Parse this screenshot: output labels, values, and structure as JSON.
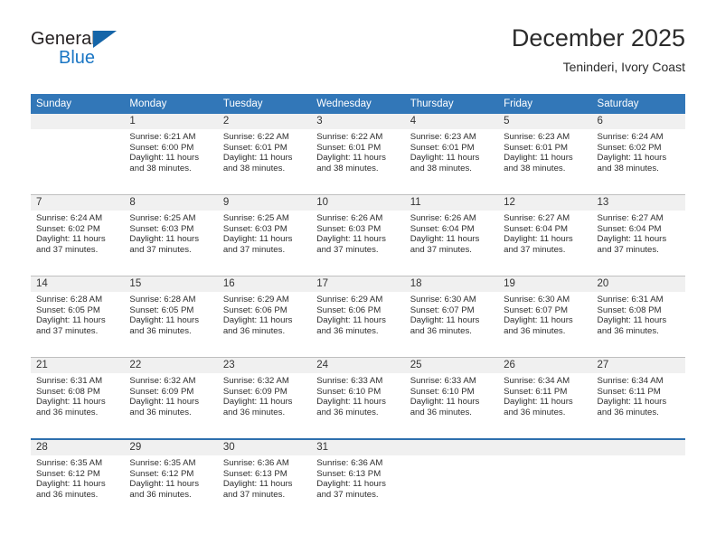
{
  "brand": {
    "line1": "General",
    "line2": "Blue",
    "logo_icon": "triangle-logo-icon",
    "accent": "#1a76c4",
    "triangle_color": "#1565a8"
  },
  "header": {
    "title": "December 2025",
    "subtitle": "Teninderi, Ivory Coast"
  },
  "theme": {
    "header_row_bg": "#3277b8",
    "daynum_bg": "#f0f0f0",
    "grid_line": "#bfbfbf",
    "blue_rule": "#2e6fad",
    "text": "#2e2e2e"
  },
  "calendar": {
    "weekday_headers": [
      "Sunday",
      "Monday",
      "Tuesday",
      "Wednesday",
      "Thursday",
      "Friday",
      "Saturday"
    ],
    "labels": {
      "sunrise_prefix": "Sunrise:",
      "sunset_prefix": "Sunset:",
      "daylight_prefix": "Daylight:"
    },
    "weeks": [
      [
        {
          "day": "",
          "empty": true
        },
        {
          "day": "1",
          "sunrise": "Sunrise: 6:21 AM",
          "sunset": "Sunset: 6:00 PM",
          "daylight_l1": "Daylight: 11 hours",
          "daylight_l2": "and 38 minutes."
        },
        {
          "day": "2",
          "sunrise": "Sunrise: 6:22 AM",
          "sunset": "Sunset: 6:01 PM",
          "daylight_l1": "Daylight: 11 hours",
          "daylight_l2": "and 38 minutes."
        },
        {
          "day": "3",
          "sunrise": "Sunrise: 6:22 AM",
          "sunset": "Sunset: 6:01 PM",
          "daylight_l1": "Daylight: 11 hours",
          "daylight_l2": "and 38 minutes."
        },
        {
          "day": "4",
          "sunrise": "Sunrise: 6:23 AM",
          "sunset": "Sunset: 6:01 PM",
          "daylight_l1": "Daylight: 11 hours",
          "daylight_l2": "and 38 minutes."
        },
        {
          "day": "5",
          "sunrise": "Sunrise: 6:23 AM",
          "sunset": "Sunset: 6:01 PM",
          "daylight_l1": "Daylight: 11 hours",
          "daylight_l2": "and 38 minutes."
        },
        {
          "day": "6",
          "sunrise": "Sunrise: 6:24 AM",
          "sunset": "Sunset: 6:02 PM",
          "daylight_l1": "Daylight: 11 hours",
          "daylight_l2": "and 38 minutes."
        }
      ],
      [
        {
          "day": "7",
          "sunrise": "Sunrise: 6:24 AM",
          "sunset": "Sunset: 6:02 PM",
          "daylight_l1": "Daylight: 11 hours",
          "daylight_l2": "and 37 minutes."
        },
        {
          "day": "8",
          "sunrise": "Sunrise: 6:25 AM",
          "sunset": "Sunset: 6:03 PM",
          "daylight_l1": "Daylight: 11 hours",
          "daylight_l2": "and 37 minutes."
        },
        {
          "day": "9",
          "sunrise": "Sunrise: 6:25 AM",
          "sunset": "Sunset: 6:03 PM",
          "daylight_l1": "Daylight: 11 hours",
          "daylight_l2": "and 37 minutes."
        },
        {
          "day": "10",
          "sunrise": "Sunrise: 6:26 AM",
          "sunset": "Sunset: 6:03 PM",
          "daylight_l1": "Daylight: 11 hours",
          "daylight_l2": "and 37 minutes."
        },
        {
          "day": "11",
          "sunrise": "Sunrise: 6:26 AM",
          "sunset": "Sunset: 6:04 PM",
          "daylight_l1": "Daylight: 11 hours",
          "daylight_l2": "and 37 minutes."
        },
        {
          "day": "12",
          "sunrise": "Sunrise: 6:27 AM",
          "sunset": "Sunset: 6:04 PM",
          "daylight_l1": "Daylight: 11 hours",
          "daylight_l2": "and 37 minutes."
        },
        {
          "day": "13",
          "sunrise": "Sunrise: 6:27 AM",
          "sunset": "Sunset: 6:04 PM",
          "daylight_l1": "Daylight: 11 hours",
          "daylight_l2": "and 37 minutes."
        }
      ],
      [
        {
          "day": "14",
          "sunrise": "Sunrise: 6:28 AM",
          "sunset": "Sunset: 6:05 PM",
          "daylight_l1": "Daylight: 11 hours",
          "daylight_l2": "and 37 minutes."
        },
        {
          "day": "15",
          "sunrise": "Sunrise: 6:28 AM",
          "sunset": "Sunset: 6:05 PM",
          "daylight_l1": "Daylight: 11 hours",
          "daylight_l2": "and 36 minutes."
        },
        {
          "day": "16",
          "sunrise": "Sunrise: 6:29 AM",
          "sunset": "Sunset: 6:06 PM",
          "daylight_l1": "Daylight: 11 hours",
          "daylight_l2": "and 36 minutes."
        },
        {
          "day": "17",
          "sunrise": "Sunrise: 6:29 AM",
          "sunset": "Sunset: 6:06 PM",
          "daylight_l1": "Daylight: 11 hours",
          "daylight_l2": "and 36 minutes."
        },
        {
          "day": "18",
          "sunrise": "Sunrise: 6:30 AM",
          "sunset": "Sunset: 6:07 PM",
          "daylight_l1": "Daylight: 11 hours",
          "daylight_l2": "and 36 minutes."
        },
        {
          "day": "19",
          "sunrise": "Sunrise: 6:30 AM",
          "sunset": "Sunset: 6:07 PM",
          "daylight_l1": "Daylight: 11 hours",
          "daylight_l2": "and 36 minutes."
        },
        {
          "day": "20",
          "sunrise": "Sunrise: 6:31 AM",
          "sunset": "Sunset: 6:08 PM",
          "daylight_l1": "Daylight: 11 hours",
          "daylight_l2": "and 36 minutes."
        }
      ],
      [
        {
          "day": "21",
          "sunrise": "Sunrise: 6:31 AM",
          "sunset": "Sunset: 6:08 PM",
          "daylight_l1": "Daylight: 11 hours",
          "daylight_l2": "and 36 minutes."
        },
        {
          "day": "22",
          "sunrise": "Sunrise: 6:32 AM",
          "sunset": "Sunset: 6:09 PM",
          "daylight_l1": "Daylight: 11 hours",
          "daylight_l2": "and 36 minutes."
        },
        {
          "day": "23",
          "sunrise": "Sunrise: 6:32 AM",
          "sunset": "Sunset: 6:09 PM",
          "daylight_l1": "Daylight: 11 hours",
          "daylight_l2": "and 36 minutes."
        },
        {
          "day": "24",
          "sunrise": "Sunrise: 6:33 AM",
          "sunset": "Sunset: 6:10 PM",
          "daylight_l1": "Daylight: 11 hours",
          "daylight_l2": "and 36 minutes."
        },
        {
          "day": "25",
          "sunrise": "Sunrise: 6:33 AM",
          "sunset": "Sunset: 6:10 PM",
          "daylight_l1": "Daylight: 11 hours",
          "daylight_l2": "and 36 minutes."
        },
        {
          "day": "26",
          "sunrise": "Sunrise: 6:34 AM",
          "sunset": "Sunset: 6:11 PM",
          "daylight_l1": "Daylight: 11 hours",
          "daylight_l2": "and 36 minutes."
        },
        {
          "day": "27",
          "sunrise": "Sunrise: 6:34 AM",
          "sunset": "Sunset: 6:11 PM",
          "daylight_l1": "Daylight: 11 hours",
          "daylight_l2": "and 36 minutes."
        }
      ],
      [
        {
          "day": "28",
          "sunrise": "Sunrise: 6:35 AM",
          "sunset": "Sunset: 6:12 PM",
          "daylight_l1": "Daylight: 11 hours",
          "daylight_l2": "and 36 minutes."
        },
        {
          "day": "29",
          "sunrise": "Sunrise: 6:35 AM",
          "sunset": "Sunset: 6:12 PM",
          "daylight_l1": "Daylight: 11 hours",
          "daylight_l2": "and 36 minutes."
        },
        {
          "day": "30",
          "sunrise": "Sunrise: 6:36 AM",
          "sunset": "Sunset: 6:13 PM",
          "daylight_l1": "Daylight: 11 hours",
          "daylight_l2": "and 37 minutes."
        },
        {
          "day": "31",
          "sunrise": "Sunrise: 6:36 AM",
          "sunset": "Sunset: 6:13 PM",
          "daylight_l1": "Daylight: 11 hours",
          "daylight_l2": "and 37 minutes."
        },
        {
          "day": "",
          "empty": true
        },
        {
          "day": "",
          "empty": true
        },
        {
          "day": "",
          "empty": true
        }
      ]
    ]
  }
}
